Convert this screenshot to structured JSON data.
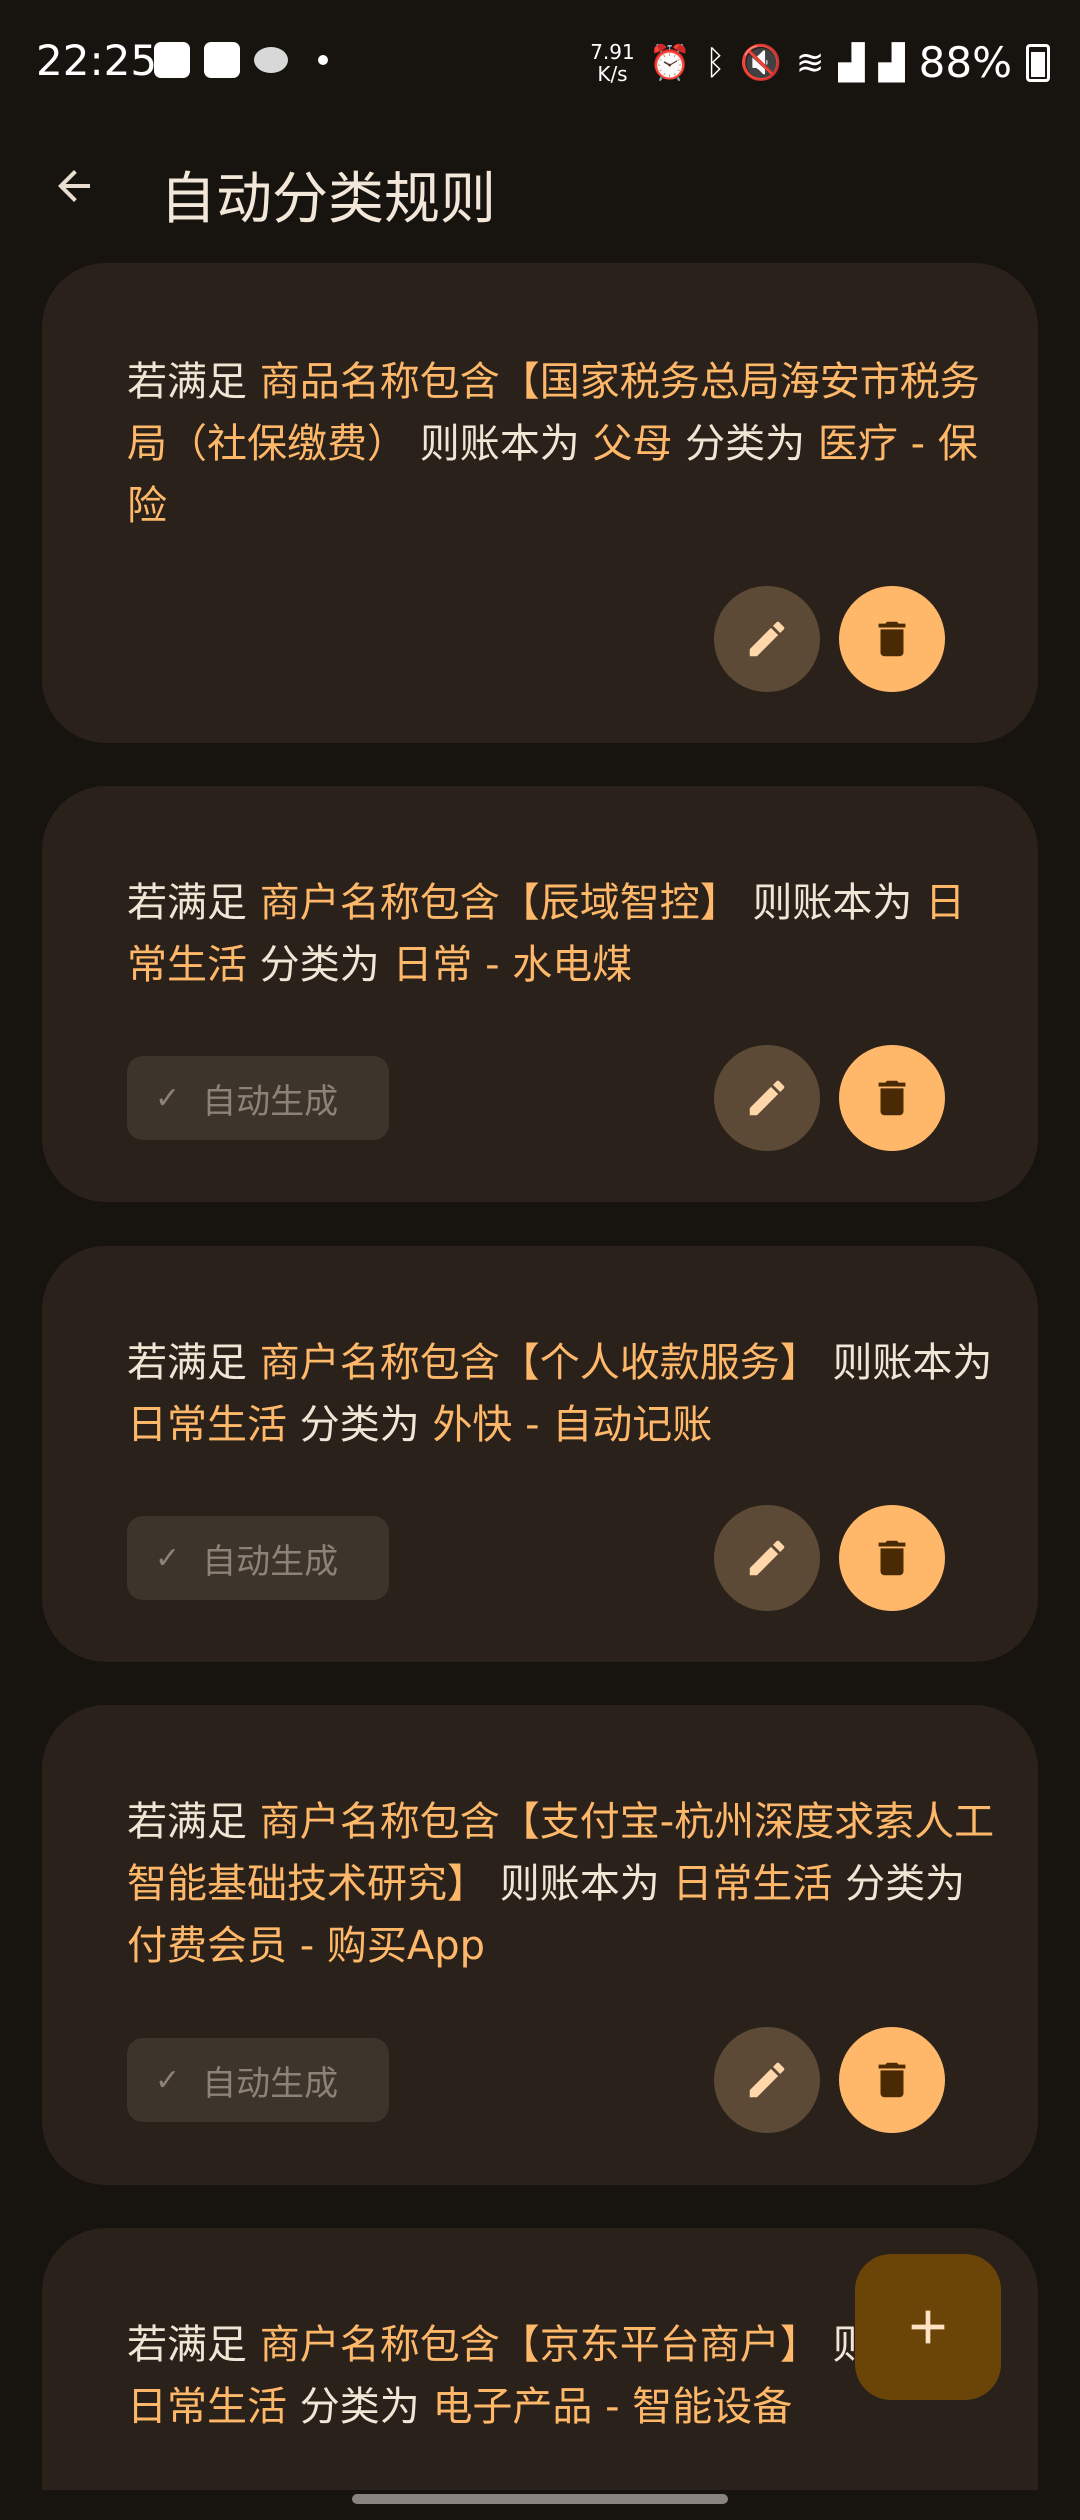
{
  "status_bar": {
    "time": "22:25",
    "speed_value": "7.91",
    "speed_unit": "K/s",
    "battery": "88%"
  },
  "header": {
    "title": "自动分类规则"
  },
  "chip_label": "自动生成",
  "rules": [
    {
      "prefix": "若满足 ",
      "condition": "商品名称包含【国家税务总局海安市税务局（社保缴费）",
      "mid1": " 则账本为 ",
      "book": "父母",
      "mid2": " 分类为 ",
      "category": "医疗 - 保险",
      "auto_generated": false
    },
    {
      "prefix": "若满足 ",
      "condition": "商户名称包含【辰域智控】",
      "mid1": " 则账本为 ",
      "book": "日常生活",
      "mid2": " 分类为 ",
      "category": "日常 - 水电煤",
      "auto_generated": true
    },
    {
      "prefix": "若满足 ",
      "condition": "商户名称包含【个人收款服务】",
      "mid1": " 则账本为 ",
      "book": "日常生活",
      "mid2": " 分类为 ",
      "category": "外快 - 自动记账",
      "auto_generated": true
    },
    {
      "prefix": "若满足 ",
      "condition": "商户名称包含【支付宝-杭州深度求索人工智能基础技术研究】",
      "mid1": " 则账本为 ",
      "book": "日常生活",
      "mid2": " 分类为 ",
      "category": "付费会员 - 购买App",
      "auto_generated": true
    },
    {
      "prefix": "若满足 ",
      "condition": "商户名称包含【京东平台商户】",
      "mid1": " 则账本为 ",
      "book": "日常生活",
      "mid2": " 分类为 ",
      "category": "电子产品 - 智能设备",
      "auto_generated": false
    }
  ],
  "colors": {
    "background": "#17130f",
    "card": "#2a221a",
    "accent": "#ffb869",
    "edit_button": "#5c4a37",
    "fab": "#6b4508"
  }
}
